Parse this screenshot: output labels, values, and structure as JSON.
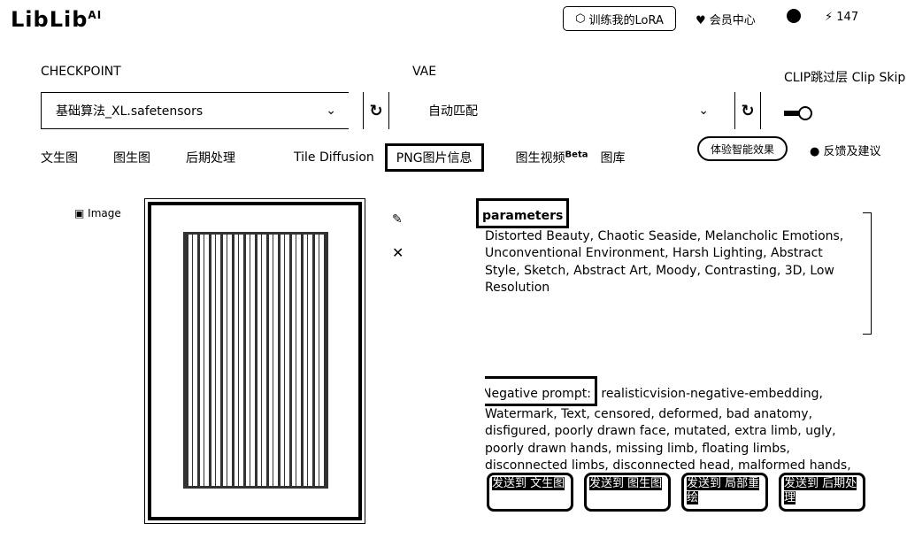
{
  "header": {
    "logo": "LibLib",
    "logo_sup": "AI",
    "train_lora": "训练我的LoRA",
    "member_center": "会员中心",
    "points": "147"
  },
  "settings": {
    "checkpoint_label": "CHECKPOINT",
    "checkpoint_value": "基础算法_XL.safetensors",
    "vae_label": "VAE",
    "vae_value": "自动匹配",
    "clip_label": "CLIP跳过层 Clip Skip"
  },
  "tabs": [
    {
      "label": "文生图"
    },
    {
      "label": "图生图"
    },
    {
      "label": "后期处理"
    },
    {
      "label": "Tile Diffusion"
    },
    {
      "label": "PNG图片信息"
    },
    {
      "label": "图生视频",
      "badge": "Beta"
    },
    {
      "label": "图库"
    }
  ],
  "pill_button": "体验智能效果",
  "feedback": "反馈及建议",
  "image_label": "Image",
  "parameters": {
    "heading": "parameters",
    "text": "Distorted Beauty, Chaotic Seaside, Melancholic Emotions, Unconventional Environment, Harsh Lighting, Abstract Style, Sketch, Abstract Art, Moody, Contrasting, 3D, Low Resolution"
  },
  "negative": {
    "heading": "Negative prompt:",
    "text": "realisticvision-negative-embedding, Watermark, Text, censored, deformed, bad anatomy, disfigured, poorly drawn face, mutated, extra limb, ugly, poorly drawn hands, missing limb, floating limbs, disconnected limbs, disconnected head, malformed hands, long neck, mutated"
  },
  "actions": [
    "发送到 文生图",
    "发送到 图生图",
    "发送到 局部重绘",
    "发送到 后期处理"
  ]
}
